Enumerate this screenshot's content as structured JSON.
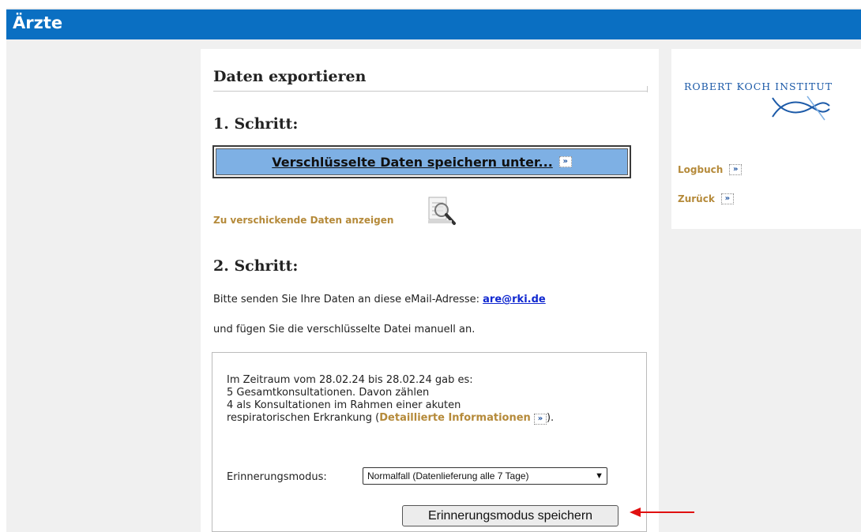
{
  "header": {
    "title": "Ärzte"
  },
  "main": {
    "section_title": "Daten exportieren",
    "step1_title": "1. Schritt:",
    "save_button_label": "Verschlüsselte Daten speichern unter...",
    "show_data_link": "Zu verschickende Daten anzeigen",
    "step2_title": "2. Schritt:",
    "send_text": "Bitte senden Sie Ihre Daten an diese eMail-Adresse: ",
    "email": "are@rki.de",
    "attach_text": "und fügen Sie die verschlüsselte Datei manuell an.",
    "info": {
      "line1": "Im Zeitraum vom 28.02.24 bis 28.02.24 gab es:",
      "line2": "5 Gesamtkonsultationen. Davon zählen",
      "line3": "4 als Konsultationen im Rahmen einer akuten",
      "line4_prefix": "respiratorischen Erkrankung (",
      "detail_link": "Detaillierte Informationen",
      "line4_suffix": ")."
    },
    "reminder_label": "Erinnerungsmodus:",
    "reminder_selected": "Normalfall (Datenlieferung alle 7 Tage)",
    "reminder_save_button": "Erinnerungsmodus speichern"
  },
  "sidebar": {
    "logo_text": "ROBERT KOCH INSTITUT",
    "links": [
      {
        "label": "Logbuch"
      },
      {
        "label": "Zurück"
      }
    ]
  },
  "colors": {
    "header_bg": "#0a6fc2",
    "button_bg": "#7eb0e4",
    "link_gold": "#b58a3a",
    "email_blue": "#1028d0",
    "rki_blue": "#1c5aa8",
    "annotation_red": "#e01010"
  },
  "icons": {
    "arrow": "double-chevron-right-icon",
    "magnifier": "document-search-icon",
    "rki": "rki-logo-mark"
  }
}
